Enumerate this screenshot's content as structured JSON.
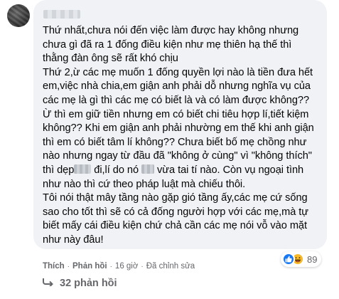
{
  "comment": {
    "paragraphs": [
      "Thứ nhất,chưa nói đến việc làm được hay không nhưng chưa gì đã ra 1 đống điều kiện như mẹ thiên hạ thế thì thằng đàn ông sẽ rất khó chịu",
      "Thứ 2,ừ các mẹ muốn 1 đống quyền lợi nào là tiền đưa hết em,việc nhà chia,em giận anh phải dỗ nhưng nghĩa vụ của các mẹ là gì thì các mẹ có biết là và có làm được không?? Ừ thì em giữ tiền nhưng em có biết chi tiêu hợp lí,tiết kiệm không?? Khi em giận anh phải nhường em thế khi anh giận thì em có biết tâm lí không?? Chưa biết bố mẹ chồng như nào nhưng ngay từ đầu đã \"không ở cùng\" vì \"không thích\" thì dẹp",
      " đi,lí do nó ",
      " vừa tai tí nào. Còn vụ ngoại tình như nào thì cứ theo pháp luật mà chiếu thôi.",
      "Tôi nói thật mây tầng nào gặp gió tầng ấy,các mẹ cứ sống sao cho tốt thì sẽ có cả đống người hợp với các mẹ,mà tự biết mấy cái điều kiện chứ chả cần các mẹ nói vỗ vào mặt như này đâu!"
    ]
  },
  "reactions": {
    "count": "89",
    "icons": [
      "like-icon",
      "haha-icon"
    ]
  },
  "actions": {
    "like": "Thích",
    "reply": "Phản hồi",
    "time": "16 giờ",
    "edited": "Đã chỉnh sửa",
    "separator": "·"
  },
  "replies": {
    "label": "32 phản hồi"
  },
  "colors": {
    "bubble": "#f0f2f5",
    "like": "#1877f2",
    "haha": "#f7b928",
    "meta": "#65676b"
  }
}
